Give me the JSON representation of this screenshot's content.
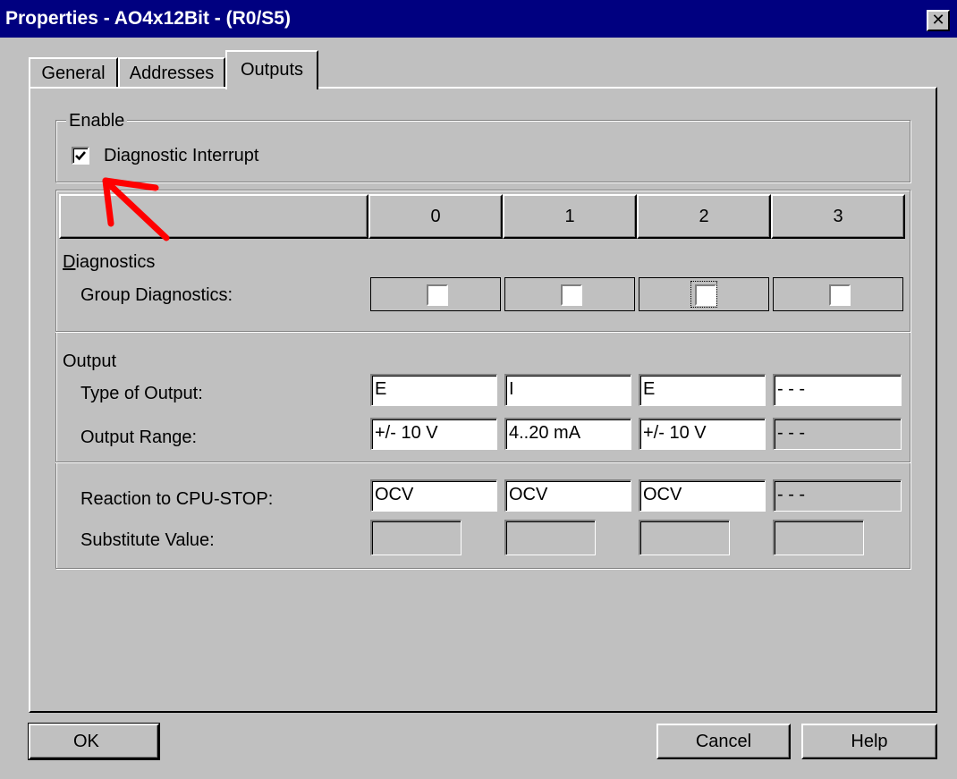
{
  "window": {
    "title": "Properties - AO4x12Bit - (R0/S5)",
    "close_icon": "close-icon"
  },
  "tabs": [
    {
      "label": "General",
      "active": false
    },
    {
      "label": "Addresses",
      "active": false
    },
    {
      "label": "Outputs",
      "active": true
    }
  ],
  "enable": {
    "group_label": "Enable",
    "diagnostic_interrupt": {
      "label": "Diagnostic Interrupt",
      "checked": true
    }
  },
  "channels": {
    "headers": [
      "",
      "0",
      "1",
      "2",
      "3"
    ],
    "diagnostics": {
      "section_label": "Diagnostics",
      "group_diagnostics_label": "Group Diagnostics:",
      "group_diagnostics": [
        false,
        false,
        false,
        false
      ]
    },
    "output": {
      "section_label": "Output",
      "type_label": "Type of Output:",
      "type_values": [
        "E",
        "I",
        "E",
        "- - -"
      ],
      "range_label": "Output Range:",
      "range_values": [
        "+/- 10 V",
        "4..20 mA",
        "+/- 10 V",
        "- - -"
      ]
    },
    "cpu_stop": {
      "reaction_label": "Reaction to CPU-STOP:",
      "reaction_values": [
        "OCV",
        "OCV",
        "OCV",
        "- - -"
      ],
      "substitute_label": "Substitute Value:",
      "substitute_values": [
        "",
        "",
        "",
        ""
      ]
    }
  },
  "buttons": {
    "ok": "OK",
    "cancel": "Cancel",
    "help": "Help"
  },
  "annotation": {
    "arrow_color": "#ff0000"
  },
  "colors": {
    "titlebar": "#000080",
    "face": "#c0c0c0"
  }
}
